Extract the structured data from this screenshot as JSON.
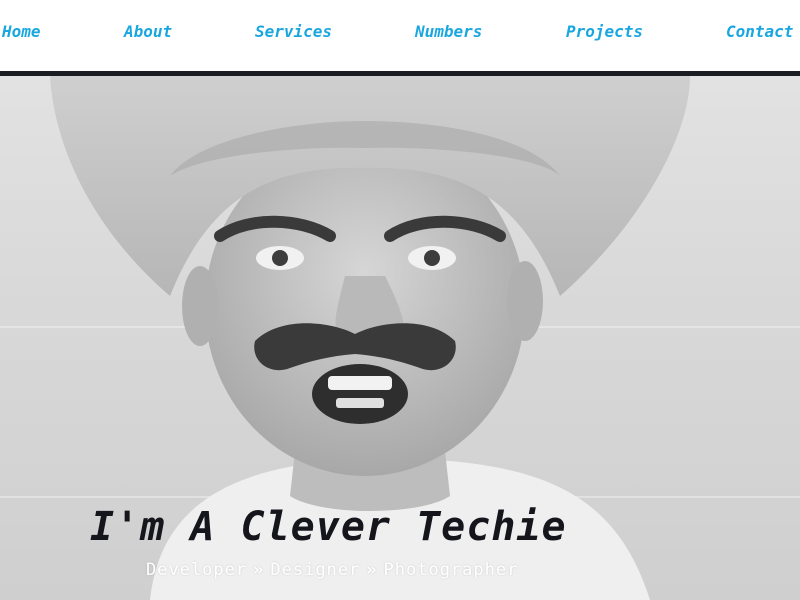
{
  "nav": {
    "items": [
      "Home",
      "About",
      "Services",
      "Numbers",
      "Projects",
      "Contact"
    ]
  },
  "hero": {
    "heading": "I'm A Clever Techie",
    "roles": [
      "Developer",
      "Designer",
      "Photographer"
    ],
    "separator": "»",
    "image_alt": "black and white portrait of a man in a large hat with a fake mustache"
  },
  "colors": {
    "nav_link": "#1aa7e0",
    "nav_rule": "#1c1c24",
    "heading": "#15151c",
    "subtitle": "#ffffff"
  }
}
